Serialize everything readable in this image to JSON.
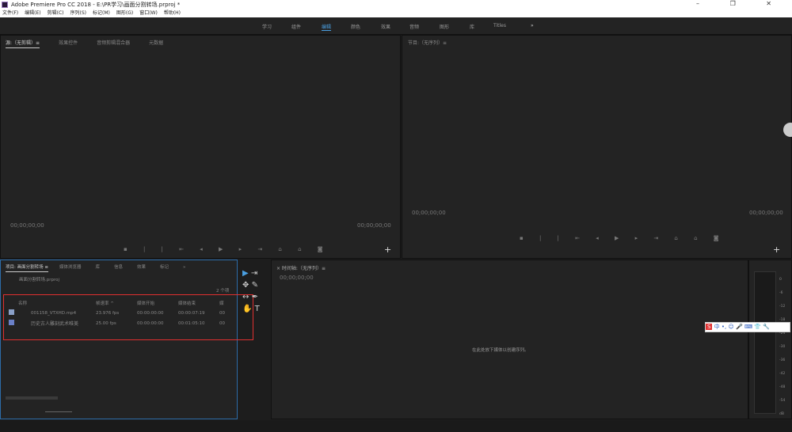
{
  "window": {
    "title": "Adobe Premiere Pro CC 2018 - E:\\PR学习\\画面分割转场.prproj *",
    "controls": "–  ❐  ✕"
  },
  "menu": [
    "文件(F)",
    "编辑(E)",
    "剪辑(C)",
    "序列(S)",
    "标记(M)",
    "图形(G)",
    "窗口(W)",
    "帮助(H)"
  ],
  "workspaces": [
    "学习",
    "组件",
    "编辑",
    "颜色",
    "效果",
    "音频",
    "图形",
    "库",
    "Titles",
    "»"
  ],
  "source": {
    "tabs": [
      "源:（无剪辑）≡",
      "效果控件",
      "音频剪辑混合器",
      "元数据"
    ],
    "tc_left": "00;00;00;00",
    "tc_right": "00;00;00;00",
    "add": "+"
  },
  "program": {
    "title": "节目:（无序列）≡",
    "tc_left": "00;00;00;00",
    "tc_right": "00;00;00;00",
    "add": "+"
  },
  "transport": "▪ | |  ⇤ ◂ ▶ ▸ ⇥  ⌂ ⌂ ◙",
  "project": {
    "tabs": [
      "项目: 画面分割转场 ≡",
      "媒体浏览器",
      "库",
      "信息",
      "效果",
      "标记",
      "»"
    ],
    "file": "画面分割转场.prproj",
    "count": "2 个项",
    "columns": [
      "名称",
      "帧速率 ^",
      "媒体开始",
      "媒体结束",
      "媒"
    ],
    "rows": [
      [
        "001158_VTXHD.mp4",
        "23.976 fps",
        "00:00:00:00",
        "00:00:07:19",
        "00"
      ],
      [
        "历史古人雕刻武术唯美",
        "25.00 fps",
        "00:00:00:00",
        "00:01:05:10",
        "00"
      ]
    ]
  },
  "timeline": {
    "title": "× 时间轴:（无序列）≡",
    "tc": "00;00;00;00",
    "drop_hint": "在此处放下媒体以创建序列。"
  },
  "meter": {
    "ticks": [
      "0",
      "-6",
      "-12",
      "-18",
      "-24",
      "-30",
      "-36",
      "-42",
      "-48",
      "-54",
      "dB"
    ]
  },
  "ime": {
    "items": [
      "S",
      "中",
      "•,",
      "☺",
      "🎤",
      "⌨",
      "👕",
      "🔧"
    ]
  }
}
